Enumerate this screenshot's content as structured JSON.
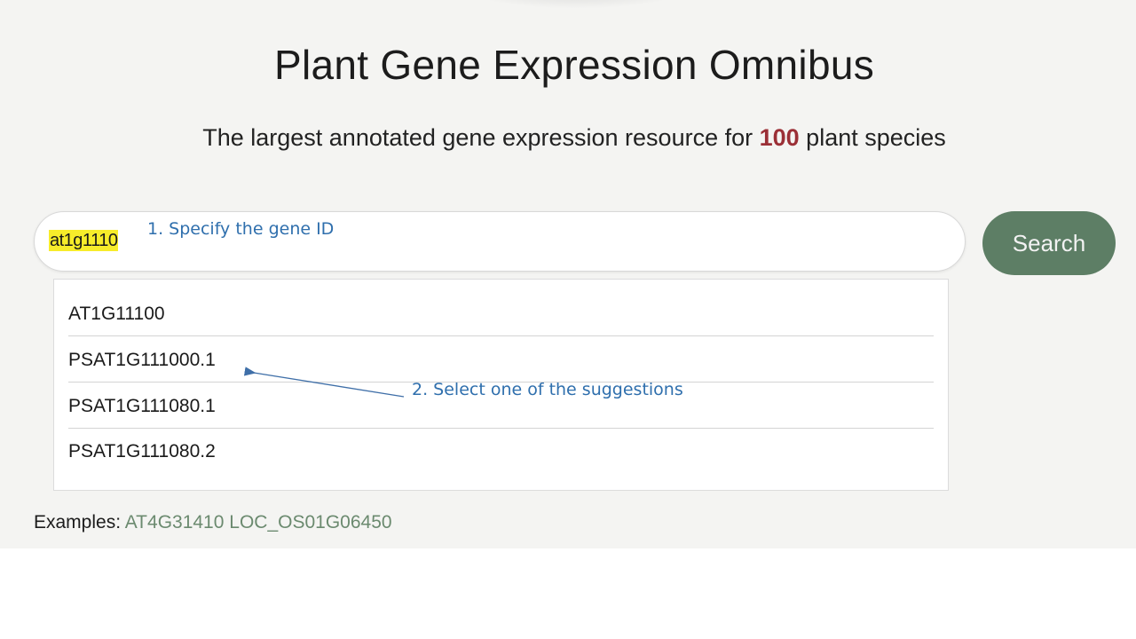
{
  "header": {
    "title": "Plant Gene Expression Omnibus",
    "subtitle_before": "The largest annotated gene expression resource for ",
    "subtitle_count": "100",
    "subtitle_after": " plant species"
  },
  "search": {
    "value": "at1g1110",
    "button_label": "Search"
  },
  "suggestions": [
    "AT1G11100",
    "PSAT1G111000.1",
    "PSAT1G111080.1",
    "PSAT1G111080.2"
  ],
  "examples": {
    "label": "Examples:",
    "items": [
      "AT4G31410",
      "LOC_OS01G06450"
    ]
  },
  "annotations": {
    "step1": "1. Specify the gene ID",
    "step2": "2. Select one of the suggestions"
  },
  "colors": {
    "background": "#f4f4f2",
    "accent_count": "#9b2f36",
    "search_button": "#5d7e65",
    "example_link": "#6b8a6f",
    "highlight": "#f7ec2a",
    "annotation": "#2f6fad"
  }
}
